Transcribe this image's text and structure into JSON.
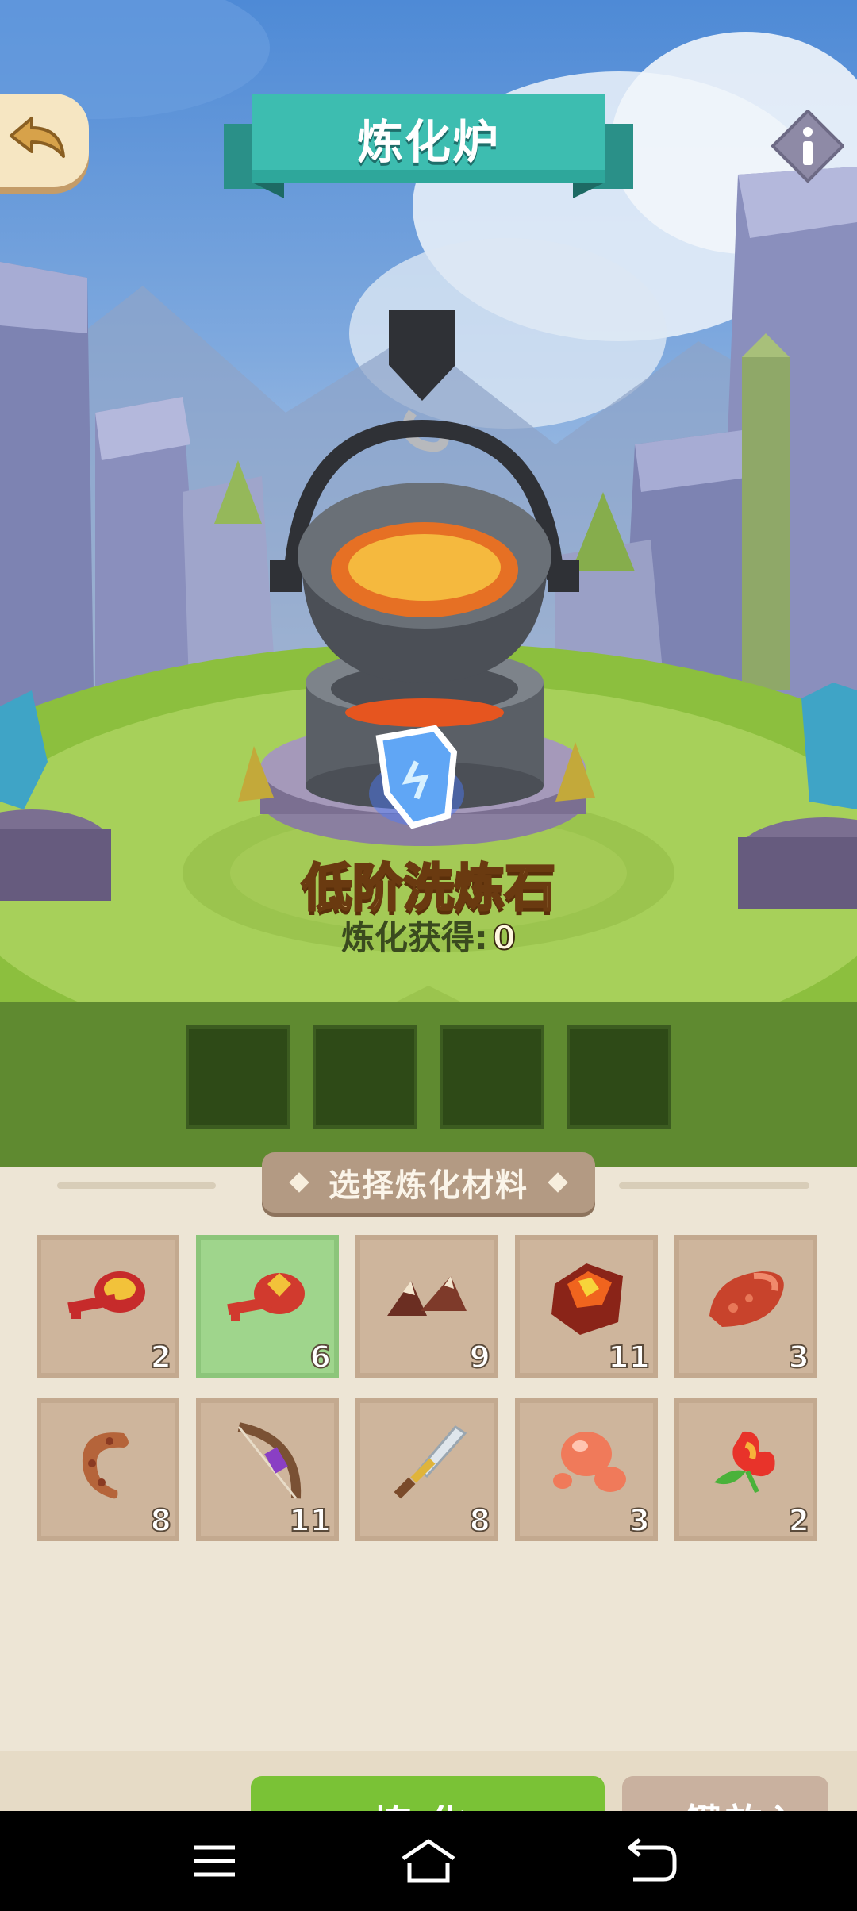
{
  "header": {
    "title": "炼化炉"
  },
  "forge": {
    "item_name": "低阶洗炼石",
    "yield_label": "炼化获得:",
    "yield_value": "0"
  },
  "materials_panel": {
    "title": "选择炼化材料",
    "items": [
      {
        "icon": "red-key-icon",
        "count": "2",
        "selected": false
      },
      {
        "icon": "gold-key-icon",
        "count": "6",
        "selected": true
      },
      {
        "icon": "horns-icon",
        "count": "9",
        "selected": false
      },
      {
        "icon": "lava-rock-icon",
        "count": "11",
        "selected": false
      },
      {
        "icon": "meat-icon",
        "count": "3",
        "selected": false
      },
      {
        "icon": "sausage-icon",
        "count": "8",
        "selected": false
      },
      {
        "icon": "bow-icon",
        "count": "11",
        "selected": false
      },
      {
        "icon": "sword-icon",
        "count": "8",
        "selected": false
      },
      {
        "icon": "slime-icon",
        "count": "3",
        "selected": false
      },
      {
        "icon": "flower-icon",
        "count": "2",
        "selected": false
      }
    ]
  },
  "actions": {
    "smelt_label": "炼化",
    "autofill_label": "一键放入"
  },
  "colors": {
    "title_teal": "#3dbdb0",
    "smelt_green": "#7ac236",
    "selected_slot": "#9fd58c",
    "panel_bg": "#ede5d5"
  }
}
